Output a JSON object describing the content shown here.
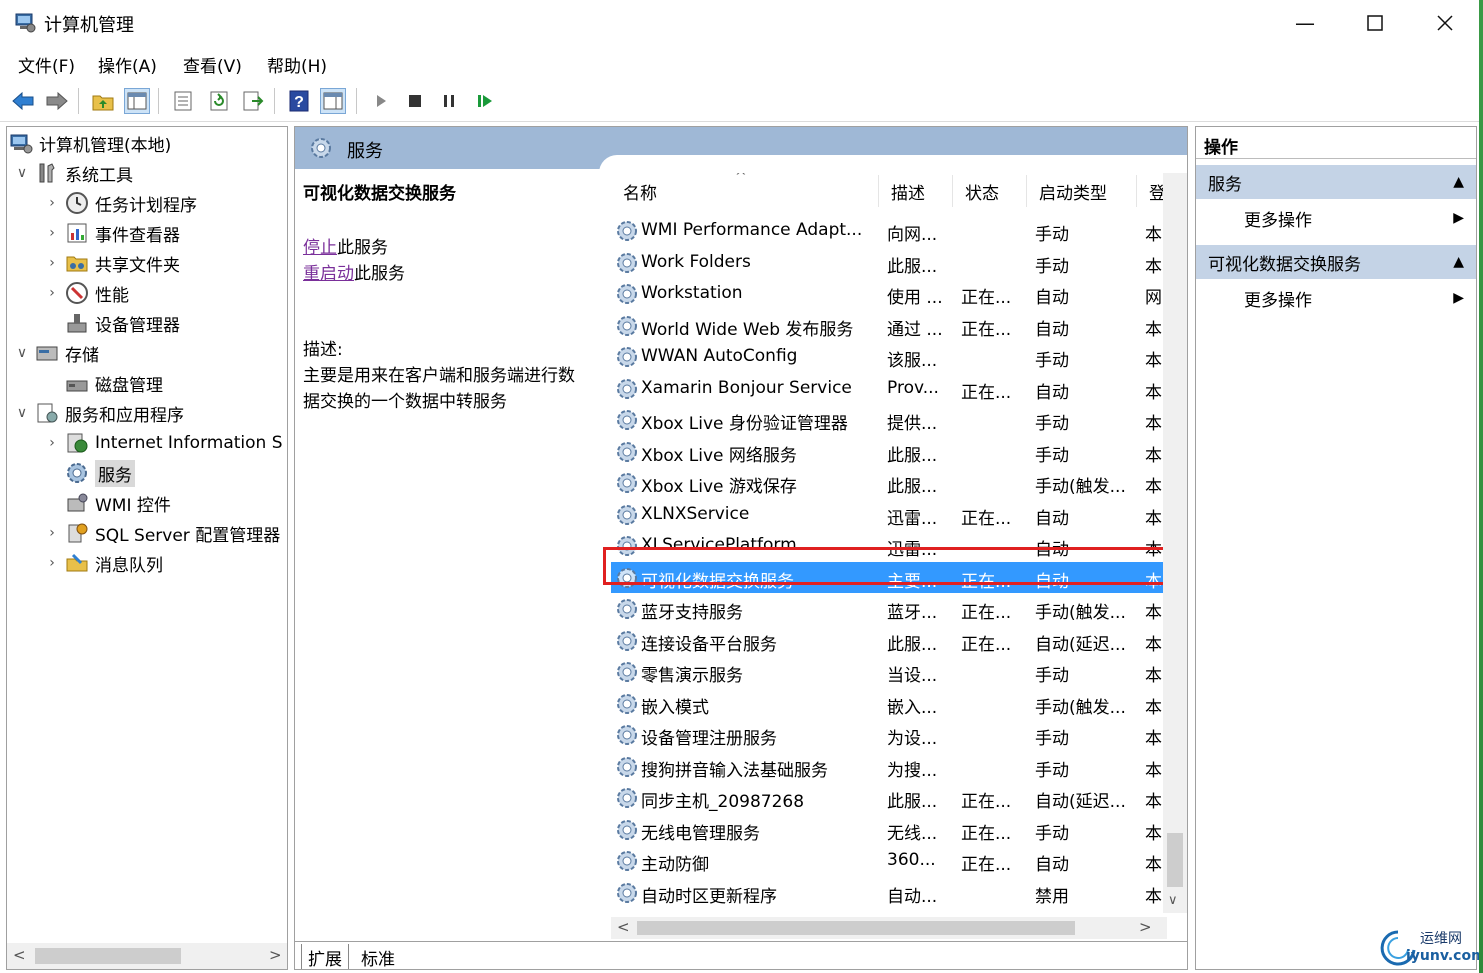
{
  "window": {
    "title": "计算机管理"
  },
  "menu": [
    "文件(F)",
    "操作(A)",
    "查看(V)",
    "帮助(H)"
  ],
  "tree": [
    {
      "label": "计算机管理(本地)",
      "expander": "",
      "indent": 0,
      "icon": "computer-icon"
    },
    {
      "label": "系统工具",
      "expander": "∨",
      "indent": 1,
      "icon": "tools-icon"
    },
    {
      "label": "任务计划程序",
      "expander": "›",
      "indent": 2,
      "icon": "clock-icon"
    },
    {
      "label": "事件查看器",
      "expander": "›",
      "indent": 2,
      "icon": "event-viewer-icon"
    },
    {
      "label": "共享文件夹",
      "expander": "›",
      "indent": 2,
      "icon": "shared-folder-icon"
    },
    {
      "label": "性能",
      "expander": "›",
      "indent": 2,
      "icon": "performance-icon"
    },
    {
      "label": "设备管理器",
      "expander": "",
      "indent": 2,
      "icon": "device-manager-icon"
    },
    {
      "label": "存储",
      "expander": "∨",
      "indent": 1,
      "icon": "storage-icon"
    },
    {
      "label": "磁盘管理",
      "expander": "",
      "indent": 2,
      "icon": "disk-icon"
    },
    {
      "label": "服务和应用程序",
      "expander": "∨",
      "indent": 1,
      "icon": "services-apps-icon"
    },
    {
      "label": "Internet Information S",
      "expander": "›",
      "indent": 2,
      "icon": "iis-icon"
    },
    {
      "label": "服务",
      "expander": "",
      "indent": 2,
      "icon": "services-gear-icon",
      "selected": true
    },
    {
      "label": "WMI 控件",
      "expander": "",
      "indent": 2,
      "icon": "wmi-icon"
    },
    {
      "label": "SQL Server 配置管理器",
      "expander": "›",
      "indent": 2,
      "icon": "sql-server-icon"
    },
    {
      "label": "消息队列",
      "expander": "›",
      "indent": 2,
      "icon": "message-queue-icon"
    }
  ],
  "center": {
    "header": "服务",
    "selected_service_name": "可视化数据交换服务",
    "stop_link": "停止",
    "stop_suffix": "此服务",
    "restart_link": "重启动",
    "restart_suffix": "此服务",
    "desc_label": "描述:",
    "desc_line1": "主要是用来在客户端和服务端进行数",
    "desc_line2": "据交换的一个数据中转服务"
  },
  "columns": [
    "名称",
    "描述",
    "状态",
    "启动类型",
    "登"
  ],
  "services": [
    {
      "name": "WMI Performance Adapt...",
      "desc": "向网...",
      "status": "",
      "startup": "手动",
      "logon": "本"
    },
    {
      "name": "Work Folders",
      "desc": "此服...",
      "status": "",
      "startup": "手动",
      "logon": "本"
    },
    {
      "name": "Workstation",
      "desc": "使用 ...",
      "status": "正在...",
      "startup": "自动",
      "logon": "网"
    },
    {
      "name": "World Wide Web 发布服务",
      "desc": "通过 ...",
      "status": "正在...",
      "startup": "自动",
      "logon": "本"
    },
    {
      "name": "WWAN AutoConfig",
      "desc": "该服...",
      "status": "",
      "startup": "手动",
      "logon": "本"
    },
    {
      "name": "Xamarin Bonjour Service",
      "desc": "Prov...",
      "status": "正在...",
      "startup": "自动",
      "logon": "本"
    },
    {
      "name": "Xbox Live 身份验证管理器",
      "desc": "提供...",
      "status": "",
      "startup": "手动",
      "logon": "本"
    },
    {
      "name": "Xbox Live 网络服务",
      "desc": "此服...",
      "status": "",
      "startup": "手动",
      "logon": "本"
    },
    {
      "name": "Xbox Live 游戏保存",
      "desc": "此服...",
      "status": "",
      "startup": "手动(触发...",
      "logon": "本"
    },
    {
      "name": "XLNXService",
      "desc": "迅雷...",
      "status": "正在...",
      "startup": "自动",
      "logon": "本"
    },
    {
      "name": "XLServicePlatform",
      "desc": "迅雷...",
      "status": "",
      "startup": "自动",
      "logon": "本"
    },
    {
      "name": "可视化数据交换服务",
      "desc": "主要...",
      "status": "正在...",
      "startup": "自动",
      "logon": "本",
      "selected": true
    },
    {
      "name": "蓝牙支持服务",
      "desc": "蓝牙...",
      "status": "正在...",
      "startup": "手动(触发...",
      "logon": "本"
    },
    {
      "name": "连接设备平台服务",
      "desc": "此服...",
      "status": "正在...",
      "startup": "自动(延迟...",
      "logon": "本"
    },
    {
      "name": "零售演示服务",
      "desc": "当设...",
      "status": "",
      "startup": "手动",
      "logon": "本"
    },
    {
      "name": "嵌入模式",
      "desc": "嵌入...",
      "status": "",
      "startup": "手动(触发...",
      "logon": "本"
    },
    {
      "name": "设备管理注册服务",
      "desc": "为设...",
      "status": "",
      "startup": "手动",
      "logon": "本"
    },
    {
      "name": "搜狗拼音输入法基础服务",
      "desc": "为搜...",
      "status": "",
      "startup": "手动",
      "logon": "本"
    },
    {
      "name": "同步主机_20987268",
      "desc": "此服...",
      "status": "正在...",
      "startup": "自动(延迟...",
      "logon": "本"
    },
    {
      "name": "无线电管理服务",
      "desc": "无线...",
      "status": "正在...",
      "startup": "手动",
      "logon": "本"
    },
    {
      "name": "主动防御",
      "desc": "360...",
      "status": "正在...",
      "startup": "自动",
      "logon": "本"
    },
    {
      "name": "自动时区更新程序",
      "desc": "自动...",
      "status": "",
      "startup": "禁用",
      "logon": "本"
    }
  ],
  "tabs": [
    "扩展",
    "标准"
  ],
  "actions": {
    "header": "操作",
    "section1": "服务",
    "section1_item": "更多操作",
    "section2": "可视化数据交换服务",
    "section2_item": "更多操作"
  },
  "watermark": {
    "line1": "运维网",
    "line2": "iyunv.com"
  },
  "colors": {
    "selection": "#3399ff",
    "header_blue": "#9fb8d6",
    "section_blue": "#c4d3e6",
    "highlight_outline": "#e02020",
    "link": "#7a2f9a"
  }
}
